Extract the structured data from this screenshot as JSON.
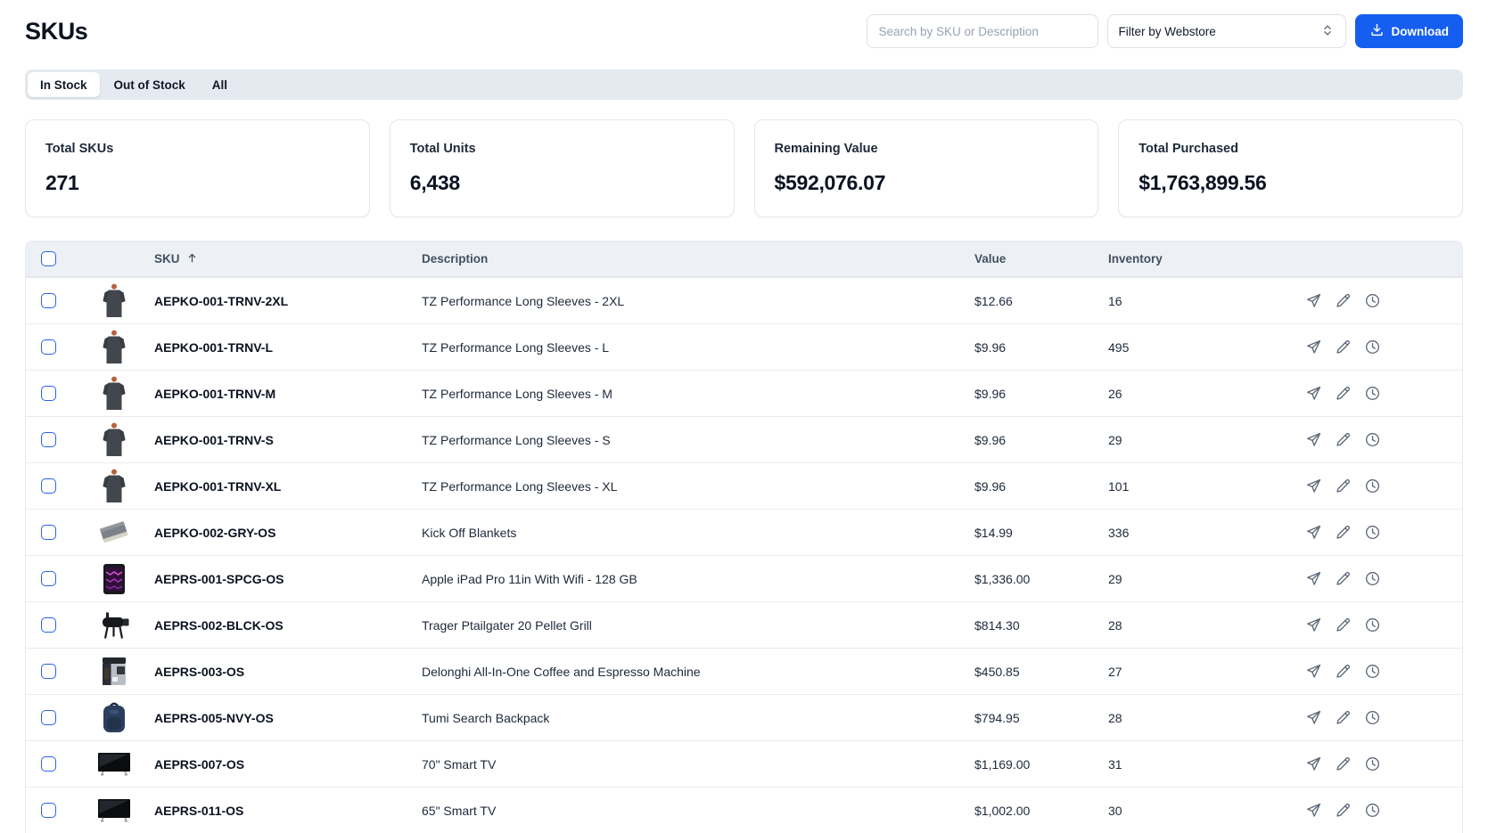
{
  "page": {
    "title": "SKUs"
  },
  "header": {
    "search_placeholder": "Search by SKU or Description",
    "filter_label": "Filter by Webstore",
    "download_label": "Download"
  },
  "tabs": [
    {
      "label": "In Stock",
      "active": true
    },
    {
      "label": "Out of Stock",
      "active": false
    },
    {
      "label": "All",
      "active": false
    }
  ],
  "stats": [
    {
      "label": "Total SKUs",
      "value": "271"
    },
    {
      "label": "Total Units",
      "value": "6,438"
    },
    {
      "label": "Remaining Value",
      "value": "$592,076.07"
    },
    {
      "label": "Total Purchased",
      "value": "$1,763,899.56"
    }
  ],
  "table": {
    "columns": {
      "sku": "SKU",
      "description": "Description",
      "value": "Value",
      "inventory": "Inventory"
    },
    "sort": {
      "column": "SKU",
      "direction": "asc"
    },
    "rows": [
      {
        "sku": "AEPKO-001-TRNV-2XL",
        "description": "TZ Performance Long Sleeves - 2XL",
        "value": "$12.66",
        "inventory": "16",
        "image": "shirt"
      },
      {
        "sku": "AEPKO-001-TRNV-L",
        "description": "TZ Performance Long Sleeves - L",
        "value": "$9.96",
        "inventory": "495",
        "image": "shirt"
      },
      {
        "sku": "AEPKO-001-TRNV-M",
        "description": "TZ Performance Long Sleeves - M",
        "value": "$9.96",
        "inventory": "26",
        "image": "shirt"
      },
      {
        "sku": "AEPKO-001-TRNV-S",
        "description": "TZ Performance Long Sleeves - S",
        "value": "$9.96",
        "inventory": "29",
        "image": "shirt"
      },
      {
        "sku": "AEPKO-001-TRNV-XL",
        "description": "TZ Performance Long Sleeves - XL",
        "value": "$9.96",
        "inventory": "101",
        "image": "shirt"
      },
      {
        "sku": "AEPKO-002-GRY-OS",
        "description": "Kick Off Blankets",
        "value": "$14.99",
        "inventory": "336",
        "image": "blanket"
      },
      {
        "sku": "AEPRS-001-SPCG-OS",
        "description": "Apple iPad Pro 11in With Wifi - 128 GB",
        "value": "$1,336.00",
        "inventory": "29",
        "image": "tablet"
      },
      {
        "sku": "AEPRS-002-BLCK-OS",
        "description": "Trager Ptailgater 20 Pellet Grill",
        "value": "$814.30",
        "inventory": "28",
        "image": "grill"
      },
      {
        "sku": "AEPRS-003-OS",
        "description": "Delonghi All-In-One Coffee and Espresso Machine",
        "value": "$450.85",
        "inventory": "27",
        "image": "coffee"
      },
      {
        "sku": "AEPRS-005-NVY-OS",
        "description": "Tumi Search Backpack",
        "value": "$794.95",
        "inventory": "28",
        "image": "backpack"
      },
      {
        "sku": "AEPRS-007-OS",
        "description": "70\" Smart TV",
        "value": "$1,169.00",
        "inventory": "31",
        "image": "tv"
      },
      {
        "sku": "AEPRS-011-OS",
        "description": "65\" Smart TV",
        "value": "$1,002.00",
        "inventory": "30",
        "image": "tv"
      }
    ]
  },
  "colors": {
    "accent": "#155EEF",
    "checkbox_border": "#2563EB",
    "table_header_bg": "#EDF1F6",
    "tabbar_bg": "#E5EAF0",
    "row_border": "#E7EBF0",
    "text_dark": "#0B1220"
  }
}
